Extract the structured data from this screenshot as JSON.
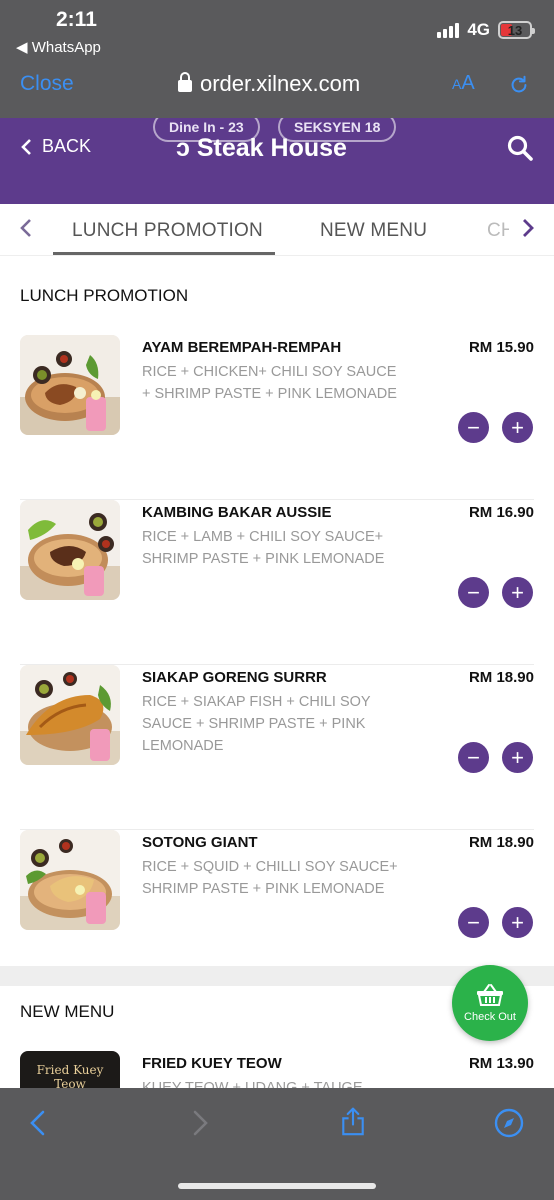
{
  "status_bar": {
    "time": "2:11",
    "back_app": "◀ WhatsApp",
    "network": "4G",
    "battery": "13"
  },
  "browser": {
    "close_label": "Close",
    "url": "order.xilnex.com",
    "text_size_label_small": "A",
    "text_size_label_large": "A"
  },
  "header": {
    "back_label": "BACK",
    "store_name": "Steak House",
    "store_name_prefix": "ɔ",
    "order_type": "Dine In - 23",
    "outlet": "SEKSYEN 18"
  },
  "tabs": [
    {
      "label": "LUNCH PROMOTION",
      "active": true
    },
    {
      "label": "NEW MENU",
      "active": false
    },
    {
      "label": "CH",
      "active": false
    }
  ],
  "sections": {
    "lunch_promotion": "LUNCH PROMOTION",
    "new_menu": "NEW MENU"
  },
  "items": [
    {
      "name": "AYAM BEREMPAH-REMPAH",
      "price": "RM 15.90",
      "desc": "RICE + CHICKEN+ CHILI SOY SAUCE + SHRIMP PASTE + PINK LEMONADE"
    },
    {
      "name": "KAMBING BAKAR AUSSIE",
      "price": "RM 16.90",
      "desc": "RICE + LAMB + CHILI SOY SAUCE+ SHRIMP PASTE + PINK LEMONADE"
    },
    {
      "name": "SIAKAP GORENG SURRR",
      "price": "RM 18.90",
      "desc": "RICE + SIAKAP FISH + CHILI SOY SAUCE + SHRIMP PASTE + PINK LEMONADE"
    },
    {
      "name": "SOTONG GIANT",
      "price": "RM 18.90",
      "desc": "RICE + SQUID + CHILLI SOY SAUCE+ SHRIMP PASTE + PINK LEMONADE"
    }
  ],
  "new_menu_item": {
    "name": "FRIED KUEY TEOW",
    "price": "RM 13.90",
    "desc": "KUEY TEOW + UDANG + TAUGE",
    "thumb_text": "Fried Kuey Teow"
  },
  "qty": {
    "minus": "−",
    "plus": "+"
  },
  "checkout_label": "Check Out",
  "colors": {
    "brand_purple": "#5d3b8c",
    "checkout_green": "#2bb24a",
    "safari_link": "#3b8ff2"
  }
}
